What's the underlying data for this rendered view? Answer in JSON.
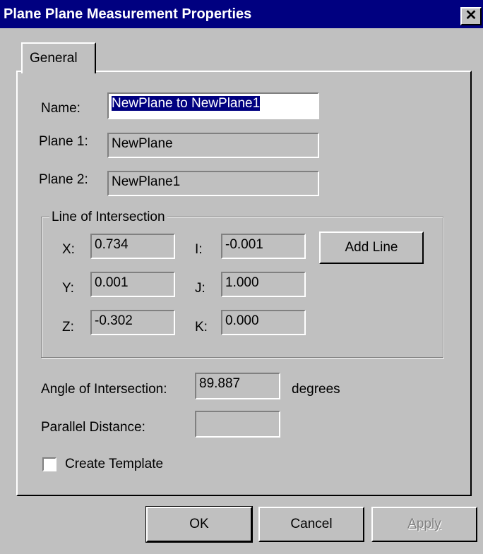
{
  "window": {
    "title": "Plane Plane Measurement Properties",
    "close_glyph": "✕"
  },
  "tabs": [
    {
      "label": "General"
    }
  ],
  "fields": {
    "name": {
      "label": "Name:",
      "value": "NewPlane to NewPlane1"
    },
    "plane1": {
      "label": "Plane 1:",
      "value": "NewPlane"
    },
    "plane2": {
      "label": "Plane 2:",
      "value": "NewPlane1"
    }
  },
  "intersection": {
    "title": "Line of Intersection",
    "x": {
      "label": "X:",
      "value": "0.734"
    },
    "y": {
      "label": "Y:",
      "value": "0.001"
    },
    "z": {
      "label": "Z:",
      "value": "-0.302"
    },
    "i": {
      "label": "I:",
      "value": "-0.001"
    },
    "j": {
      "label": "J:",
      "value": "1.000"
    },
    "k": {
      "label": "K:",
      "value": "0.000"
    },
    "add_line_label": "Add Line"
  },
  "angle": {
    "label": "Angle of Intersection:",
    "value": "89.887",
    "unit": "degrees"
  },
  "parallel": {
    "label": "Parallel Distance:",
    "value": ""
  },
  "create_template": {
    "label": "Create Template",
    "checked": false
  },
  "buttons": {
    "ok": "OK",
    "cancel": "Cancel",
    "apply": "Apply"
  }
}
